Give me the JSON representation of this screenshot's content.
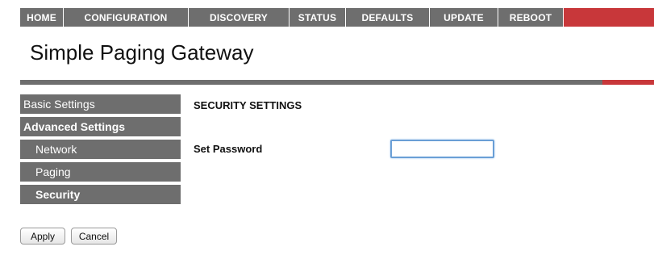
{
  "nav": {
    "items": [
      "HOME",
      "CONFIGURATION",
      "DISCOVERY",
      "STATUS",
      "DEFAULTS",
      "UPDATE",
      "REBOOT"
    ]
  },
  "page_title": "Simple Paging Gateway",
  "sidebar": {
    "items": [
      {
        "label": "Basic Settings"
      },
      {
        "label": "Advanced Settings"
      },
      {
        "label": "Network"
      },
      {
        "label": "Paging"
      },
      {
        "label": "Security"
      }
    ]
  },
  "content": {
    "section_title": "SECURITY SETTINGS",
    "password_label": "Set Password",
    "password_value": ""
  },
  "buttons": {
    "apply": "Apply",
    "cancel": "Cancel"
  },
  "colors": {
    "nav_grey": "#6e6e6e",
    "accent_red": "#c8373a",
    "input_focus_blue": "#6a9fd6"
  }
}
